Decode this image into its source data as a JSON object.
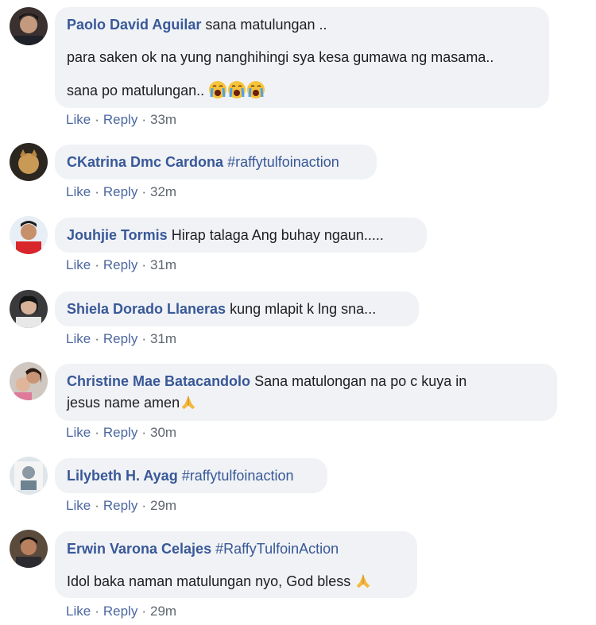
{
  "comments": [
    {
      "name": "Paolo David Aguilar",
      "lines": [
        "sana matulungan ..",
        "para saken ok na yung nanghihingi sya kesa gumawa ng masama..",
        "sana po matulungan.."
      ],
      "emoji_after_last": [
        "crying-face",
        "crying-face",
        "crying-face"
      ],
      "actions": {
        "like": "Like",
        "reply": "Reply",
        "time": "33m"
      }
    },
    {
      "name": "CKatrina Dmc Cardona",
      "tag": "#raffytulfoinaction",
      "actions": {
        "like": "Like",
        "reply": "Reply",
        "time": "32m"
      }
    },
    {
      "name": "Jouhjie Tormis",
      "lines": [
        "Hirap talaga Ang buhay ngaun....."
      ],
      "actions": {
        "like": "Like",
        "reply": "Reply",
        "time": "31m"
      }
    },
    {
      "name": "Shiela Dorado Llaneras",
      "lines": [
        "kung mlapit k lng sna..."
      ],
      "actions": {
        "like": "Like",
        "reply": "Reply",
        "time": "31m"
      }
    },
    {
      "name": "Christine Mae Batacandolo",
      "lines": [
        "Sana matulongan na po c kuya in",
        "jesus name amen"
      ],
      "emoji_after_last": [
        "folded-hands"
      ],
      "actions": {
        "like": "Like",
        "reply": "Reply",
        "time": "30m"
      }
    },
    {
      "name": "Lilybeth H. Ayag",
      "tag": "#raffytulfoinaction",
      "actions": {
        "like": "Like",
        "reply": "Reply",
        "time": "29m"
      }
    },
    {
      "name": "Erwin Varona Celajes",
      "tag": "#RaffyTulfoinAction",
      "lines": [
        "Idol baka naman matulungan nyo, God bless"
      ],
      "emoji_after_last": [
        "folded-hands"
      ],
      "actions": {
        "like": "Like",
        "reply": "Reply",
        "time": "29m"
      }
    }
  ],
  "colors": {
    "name": "#385898",
    "bubble": "#f0f2f5",
    "meta": "#606770"
  }
}
